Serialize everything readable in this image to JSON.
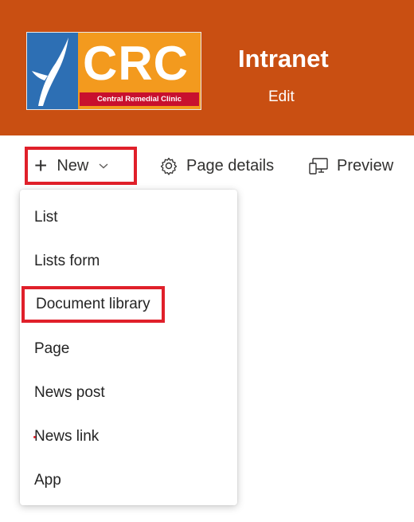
{
  "header": {
    "logo": {
      "letters": "CRC",
      "tagline": "Central Remedial Clinic"
    },
    "site_title": "Intranet",
    "edit_label": "Edit",
    "background": "#c94f12"
  },
  "toolbar": {
    "new_label": "New",
    "new_icon": "plus-icon",
    "page_details_label": "Page details",
    "page_details_icon": "gear-icon",
    "preview_label": "Preview",
    "preview_icon": "device-preview-icon"
  },
  "new_menu": {
    "items": [
      {
        "label": "List"
      },
      {
        "label": "Lists form"
      },
      {
        "label": "Document library",
        "highlighted": true
      },
      {
        "label": "Page"
      },
      {
        "label": "News post"
      },
      {
        "label": "News link"
      },
      {
        "label": "App"
      }
    ]
  },
  "highlight_color": "#e0202a"
}
